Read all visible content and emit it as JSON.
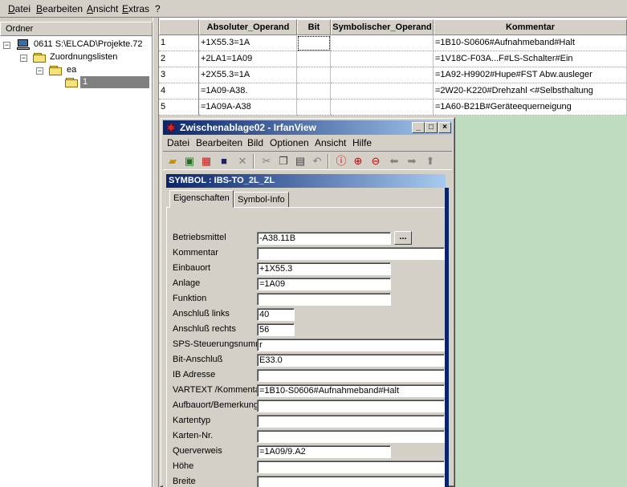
{
  "menubar": {
    "items": [
      "Datei",
      "Bearbeiten",
      "Ansicht",
      "Extras",
      "?"
    ]
  },
  "folder_panel": {
    "header": "Ordner",
    "tree": [
      {
        "label": "0611 S:\\ELCAD\\Projekte.72"
      },
      {
        "label": "Zuordnungslisten"
      },
      {
        "label": "ea"
      },
      {
        "label": "1"
      }
    ]
  },
  "grid": {
    "columns": [
      "Absoluter_Operand",
      "Bit",
      "Symbolischer_Operand",
      "Kommentar"
    ],
    "rows": [
      {
        "num": "1",
        "absoluter_operand": "+1X55.3=1A",
        "bit": "",
        "symbolischer_operand": "",
        "kommentar": "=1B10-S0606#Aufnahmeband#Halt"
      },
      {
        "num": "2",
        "absoluter_operand": "+2LA1=1A09",
        "bit": "",
        "symbolischer_operand": "",
        "kommentar": "=1V18C-F03A...F#LS-Schalter#Ein"
      },
      {
        "num": "3",
        "absoluter_operand": "+2X55.3=1A",
        "bit": "",
        "symbolischer_operand": "",
        "kommentar": "=1A92-H9902#Hupe#FST Abw.ausleger"
      },
      {
        "num": "4",
        "absoluter_operand": "=1A09-A38.",
        "bit": "",
        "symbolischer_operand": "",
        "kommentar": "=2W20-K220#Drehzahl <#Selbsthaltung"
      },
      {
        "num": "5",
        "absoluter_operand": "=1A09A-A38",
        "bit": "",
        "symbolischer_operand": "",
        "kommentar": "=1A60-B21B#Geräteequerneigung"
      }
    ]
  },
  "irfanview": {
    "title": "Zwischenablage02 - IrfanView",
    "menu": [
      "Datei",
      "Bearbeiten",
      "Bild",
      "Optionen",
      "Ansicht",
      "Hilfe"
    ],
    "toolbar_icons": [
      "open-icon",
      "thumbnails-icon",
      "grid-icon",
      "save-icon",
      "delete-icon",
      "cut-icon",
      "copy-icon",
      "paste-icon",
      "undo-icon",
      "info-icon",
      "zoom-in-icon",
      "zoom-out-icon",
      "back-icon",
      "forward-icon",
      "upload-icon"
    ],
    "dialog": {
      "title": "SYMBOL : IBS-TO_2L_ZL",
      "tabs": [
        "Eigenschaften",
        "Symbol-Info"
      ],
      "fields": [
        {
          "label": "Betriebsmittel",
          "value": "-A38.11B"
        },
        {
          "label": "Kommentar",
          "value": ""
        },
        {
          "label": "Einbauort",
          "value": "+1X55.3"
        },
        {
          "label": "Anlage",
          "value": "=1A09"
        },
        {
          "label": "Funktion",
          "value": ""
        },
        {
          "label": "Anschluß links",
          "value": "40"
        },
        {
          "label": "Anschluß rechts",
          "value": "56"
        },
        {
          "label": "SPS-Steuerungsnummer",
          "value": "r"
        },
        {
          "label": "Bit-Anschluß",
          "value": "E33.0"
        },
        {
          "label": "IB Adresse",
          "value": ""
        },
        {
          "label": "VARTEXT  /Kommentar",
          "value": "=1B10-S0606#Aufnahmeband#Halt"
        },
        {
          "label": "Aufbauort/Bemerkung",
          "value": ""
        },
        {
          "label": "Kartentyp",
          "value": ""
        },
        {
          "label": "Karten-Nr.",
          "value": ""
        },
        {
          "label": "Querverweis",
          "value": "=1A09/9.A2"
        },
        {
          "label": "Höhe",
          "value": ""
        },
        {
          "label": "Breite",
          "value": ""
        }
      ],
      "browse_label": "..."
    }
  }
}
